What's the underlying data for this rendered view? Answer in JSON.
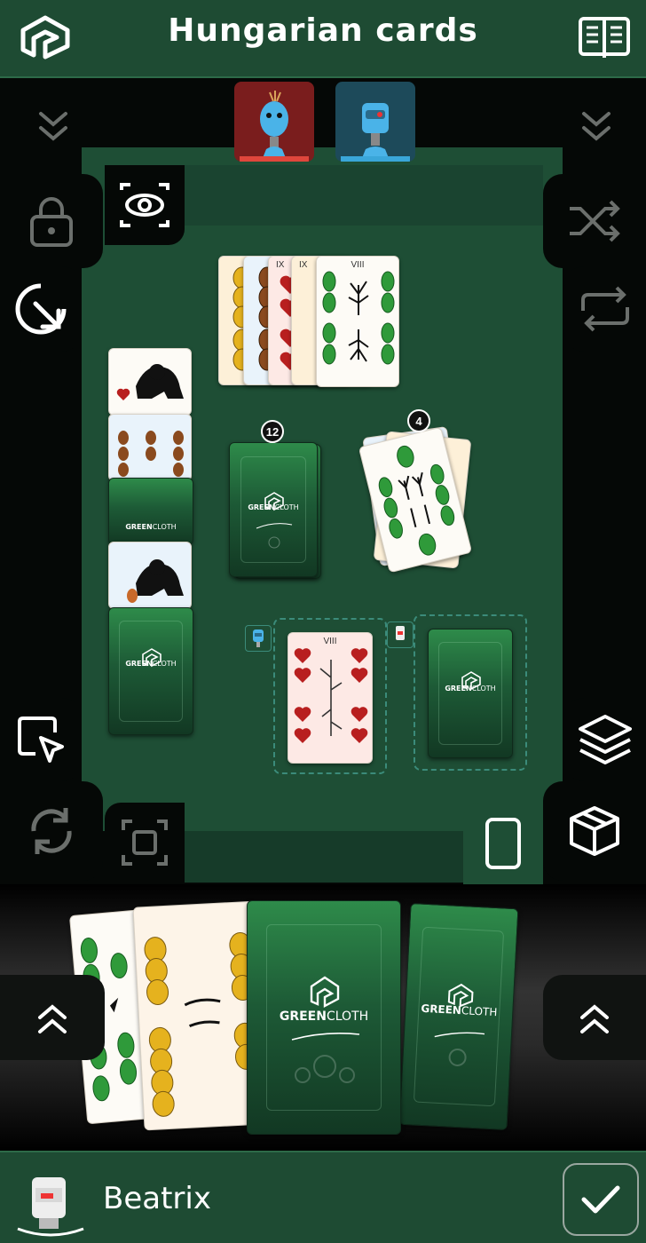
{
  "header": {
    "title": "Hungarian cards",
    "logo_icon": "greencloth-logo-icon",
    "rules_icon": "book-icon"
  },
  "opponents": [
    {
      "icon": "robot-avatar-red",
      "color": "#e0463c"
    },
    {
      "icon": "robot-avatar-blue",
      "color": "#3aa6d9"
    }
  ],
  "controls": {
    "left": [
      "collapse-down-icon",
      "lock-icon",
      "eye-icon",
      "rotate-icon",
      "select-icon",
      "refresh-icon",
      "focus-icon"
    ],
    "right": [
      "collapse-down-icon",
      "shuffle-icon",
      "swap-icon",
      "layers-icon",
      "box-icon",
      "card-portrait-icon"
    ]
  },
  "piles": {
    "draw_count": "12",
    "discard_count": "4"
  },
  "card_back": {
    "brand_bold": "GREEN",
    "brand_light": "CLOTH"
  },
  "card_ranks": {
    "top_fan": [
      "VIII",
      "IX"
    ],
    "slot_card": "VIII"
  },
  "player": {
    "name": "Beatrix",
    "confirm_icon": "check-icon"
  },
  "colors": {
    "felt": "#1e4e35",
    "header": "#1e4b33",
    "slot_border": "#3b8b7a"
  }
}
